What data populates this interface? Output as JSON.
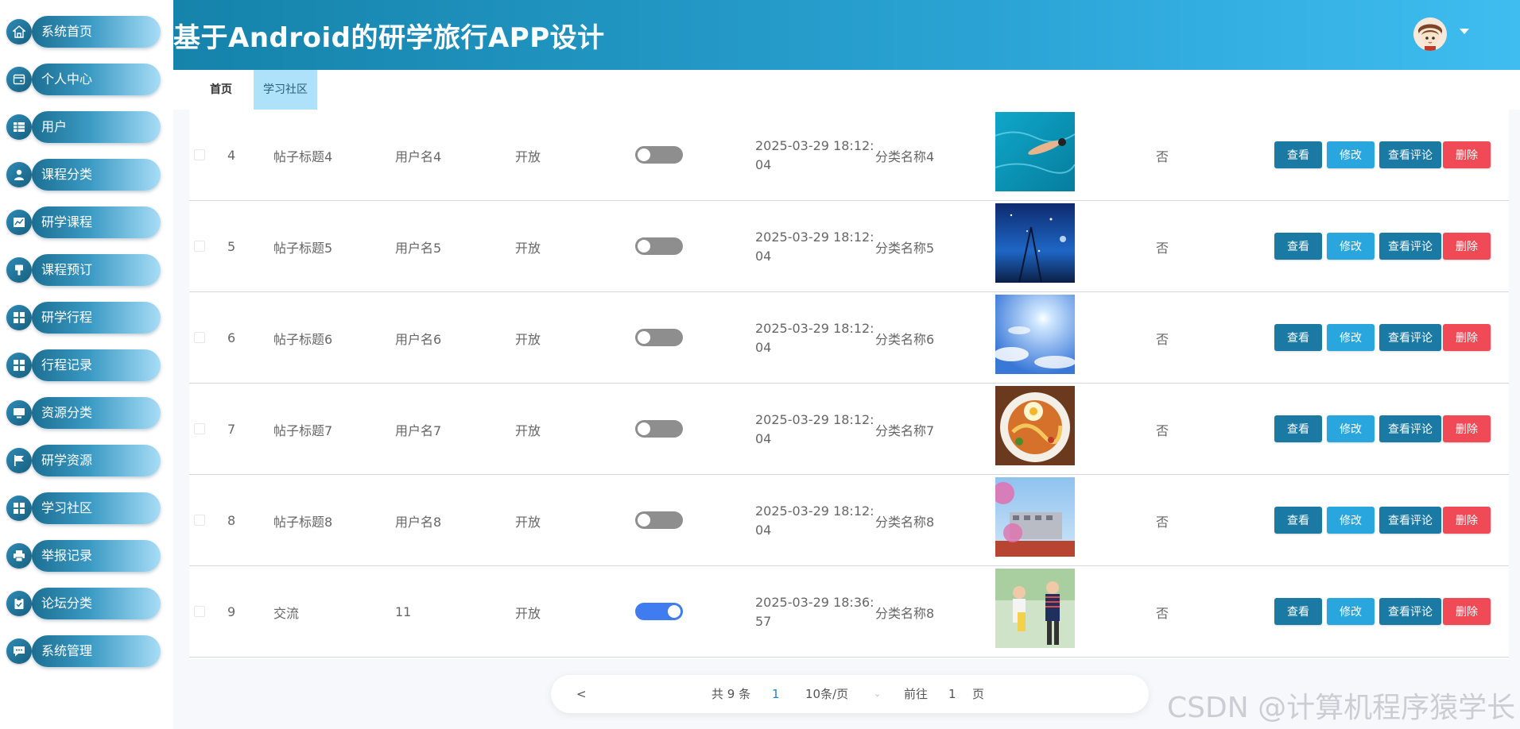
{
  "header": {
    "title": "基于Android的研学旅行APP设计"
  },
  "sidebar": {
    "items": [
      {
        "label": "系统首页",
        "icon": "home-icon"
      },
      {
        "label": "个人中心",
        "icon": "card-icon"
      },
      {
        "label": "用户",
        "icon": "grid-icon"
      },
      {
        "label": "课程分类",
        "icon": "user-icon"
      },
      {
        "label": "研学课程",
        "icon": "chart-icon"
      },
      {
        "label": "课程预订",
        "icon": "pin-icon"
      },
      {
        "label": "研学行程",
        "icon": "tiles-icon"
      },
      {
        "label": "行程记录",
        "icon": "tiles-icon"
      },
      {
        "label": "资源分类",
        "icon": "monitor-icon"
      },
      {
        "label": "研学资源",
        "icon": "flag-icon"
      },
      {
        "label": "学习社区",
        "icon": "tiles-icon"
      },
      {
        "label": "举报记录",
        "icon": "printer-icon"
      },
      {
        "label": "论坛分类",
        "icon": "clipboard-icon"
      },
      {
        "label": "系统管理",
        "icon": "chat-icon"
      }
    ]
  },
  "tabs": [
    {
      "label": "首页"
    },
    {
      "label": "学习社区"
    }
  ],
  "actions": {
    "view": "查看",
    "edit": "修改",
    "comments": "查看评论",
    "delete": "删除"
  },
  "rows": [
    {
      "index": "4",
      "title": "帖子标题4",
      "user": "用户名4",
      "status": "开放",
      "switch_on": false,
      "time_line1": "2025-03-29 18:12:",
      "time_line2": "04",
      "category": "分类名称4",
      "image": "swimmer-photo",
      "flag": "否"
    },
    {
      "index": "5",
      "title": "帖子标题5",
      "user": "用户名5",
      "status": "开放",
      "switch_on": false,
      "time_line1": "2025-03-29 18:12:",
      "time_line2": "04",
      "category": "分类名称5",
      "image": "night-sky-photo",
      "flag": "否"
    },
    {
      "index": "6",
      "title": "帖子标题6",
      "user": "用户名6",
      "status": "开放",
      "switch_on": false,
      "time_line1": "2025-03-29 18:12:",
      "time_line2": "04",
      "category": "分类名称6",
      "image": "sun-sky-photo",
      "flag": "否"
    },
    {
      "index": "7",
      "title": "帖子标题7",
      "user": "用户名7",
      "status": "开放",
      "switch_on": false,
      "time_line1": "2025-03-29 18:12:",
      "time_line2": "04",
      "category": "分类名称7",
      "image": "food-plate-photo",
      "flag": "否"
    },
    {
      "index": "8",
      "title": "帖子标题8",
      "user": "用户名8",
      "status": "开放",
      "switch_on": false,
      "time_line1": "2025-03-29 18:12:",
      "time_line2": "04",
      "category": "分类名称8",
      "image": "campus-photo",
      "flag": "否"
    },
    {
      "index": "9",
      "title": "交流",
      "user": "11",
      "status": "开放",
      "switch_on": true,
      "time_line1": "2025-03-29 18:36:",
      "time_line2": "57",
      "category": "分类名称8",
      "image": "students-photo",
      "flag": "否"
    }
  ],
  "pagination": {
    "prev": "<",
    "total": "共 9 条",
    "current_page": "1",
    "page_size": "10条/页",
    "goto_prefix": "前往",
    "goto_value": "1",
    "goto_suffix": "页"
  },
  "watermark": "CSDN @计算机程序猿学长"
}
